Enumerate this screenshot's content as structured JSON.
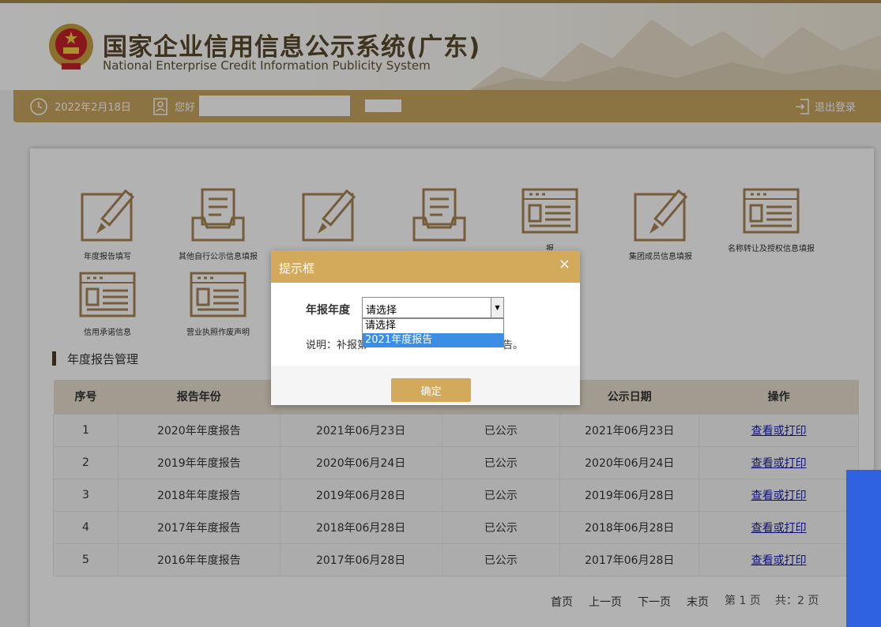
{
  "header": {
    "title_cn": "国家企业信用信息公示系统(广东)",
    "title_en": "National Enterprise Credit Information Publicity System"
  },
  "infobar": {
    "date": "2022年2月18日",
    "greeting": "您好",
    "logout": "退出登录"
  },
  "tiles": [
    {
      "label": "年度报告填写",
      "icon": "edit-pencil-icon"
    },
    {
      "label": "其他自行公示信息填报",
      "icon": "inbox-tray-icon"
    },
    {
      "label": "",
      "icon": "edit-pencil-icon"
    },
    {
      "label": "",
      "icon": "inbox-tray-icon"
    },
    {
      "label": "报",
      "icon": "info-card-icon"
    },
    {
      "label": "集团成员信息填报",
      "icon": "edit-pencil-icon"
    },
    {
      "label": "名称转让及授权信息填报",
      "icon": "info-card-icon"
    },
    {
      "label": "信用承诺信息",
      "icon": "info-card-icon"
    },
    {
      "label": "营业执照作废声明",
      "icon": "info-card-icon"
    }
  ],
  "section": {
    "title": "年度报告管理"
  },
  "table": {
    "headers": [
      "序号",
      "报告年份",
      "",
      "",
      "公示日期",
      "操作"
    ],
    "rows": [
      [
        "1",
        "2020年年度报告",
        "2021年06月23日",
        "已公示",
        "2021年06月23日",
        "查看或打印"
      ],
      [
        "2",
        "2019年年度报告",
        "2020年06月24日",
        "已公示",
        "2020年06月24日",
        "查看或打印"
      ],
      [
        "3",
        "2018年年度报告",
        "2019年06月28日",
        "已公示",
        "2019年06月28日",
        "查看或打印"
      ],
      [
        "4",
        "2017年年度报告",
        "2018年06月28日",
        "已公示",
        "2018年06月28日",
        "查看或打印"
      ],
      [
        "5",
        "2016年年度报告",
        "2017年06月28日",
        "已公示",
        "2017年06月28日",
        "查看或打印"
      ]
    ]
  },
  "pager": {
    "first": "首页",
    "prev": "上一页",
    "next": "下一页",
    "last": "末页",
    "current": "第 1 页",
    "total": "共：2 页"
  },
  "dialog": {
    "title": "提示框",
    "close": "×",
    "field_label": "年报年度",
    "select_value": "请选择",
    "options": [
      "请选择",
      "2021年度报告"
    ],
    "selected_option": "2021年度报告",
    "note_prefix": "说明：补报第",
    "note_suffix": "告。",
    "confirm": "确定"
  },
  "colors": {
    "accent": "#c9a55f",
    "dialog_header": "#d3a95c",
    "icon_brown": "#a88553",
    "link": "#1a1aa6",
    "selected_option": "#3a8ee6"
  }
}
